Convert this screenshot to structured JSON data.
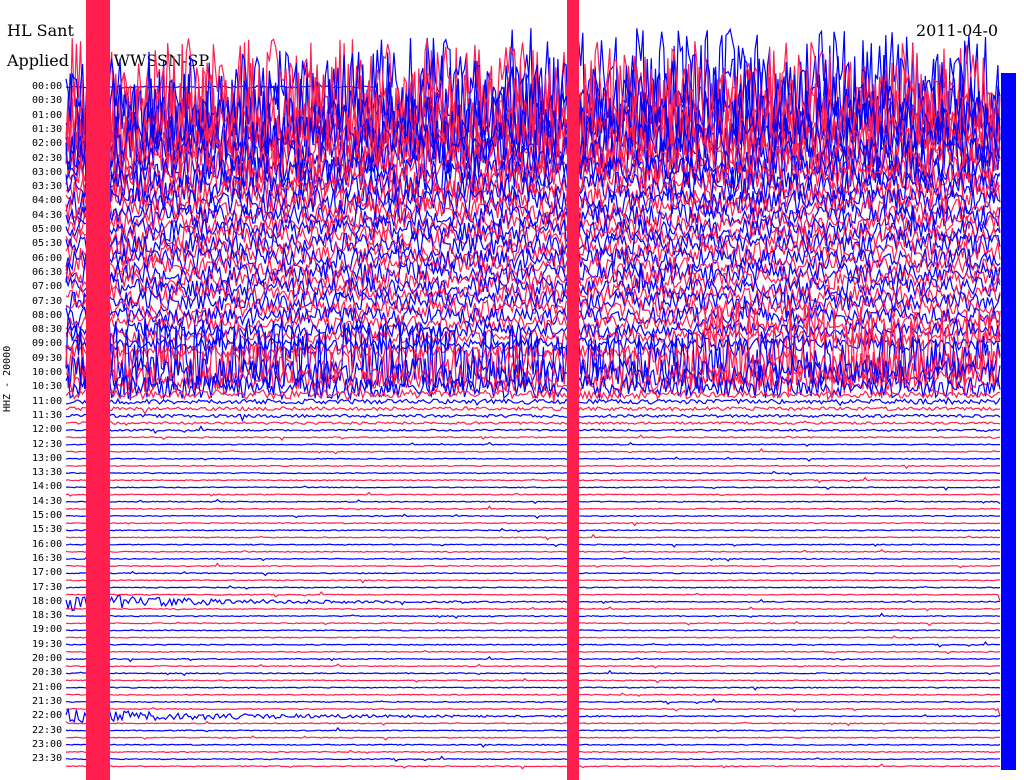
{
  "header": {
    "station": "HL Sant",
    "date": "2011-04-0",
    "filter_label": "Applied",
    "filter_value": ": WWSSN-SP"
  },
  "y_axis_label": "HHZ - 20000",
  "colors": {
    "trace_a": "#0000ff",
    "trace_b": "#ff1f4f",
    "background": "#ffffff"
  },
  "chart_data": {
    "type": "line",
    "title": "",
    "xlabel": "",
    "ylabel": "HHZ - 20000",
    "channel": "HHZ",
    "scale": 20000,
    "row_interval_minutes": 15,
    "hour_labels": [
      "00:00",
      "00:30",
      "01:00",
      "01:30",
      "02:00",
      "02:30",
      "03:00",
      "03:30",
      "04:00",
      "04:30",
      "05:00",
      "05:30",
      "06:00",
      "06:30",
      "07:00",
      "07:30",
      "08:00",
      "08:30",
      "09:00",
      "09:30",
      "10:00",
      "10:30",
      "11:00",
      "11:30",
      "12:00",
      "12:30",
      "13:00",
      "13:30",
      "14:00",
      "14:30",
      "15:00",
      "15:30",
      "16:00",
      "16:30",
      "17:00",
      "17:30",
      "18:00",
      "18:30",
      "19:00",
      "19:30",
      "20:00",
      "20:30",
      "21:00",
      "21:30",
      "22:00",
      "22:30",
      "23:00",
      "23:30"
    ],
    "row_count": 96,
    "series": [
      {
        "color": "#0000ff"
      },
      {
        "color": "#ff1f4f"
      }
    ],
    "noise_level": [
      0.15,
      0.15,
      0.15,
      0.15,
      0.15,
      0.15,
      0.15,
      0.15,
      0.15,
      0.15,
      0.16,
      0.16,
      0.16,
      0.16,
      0.17,
      0.17,
      0.18,
      0.2,
      0.25,
      0.3,
      0.55,
      0.55,
      0.75,
      0.75,
      0.85,
      0.85,
      1.0,
      1.0,
      1.05,
      1.05,
      1.05,
      1.05,
      1.05,
      1.0,
      0.9,
      0.9,
      0.75,
      0.85,
      0.95,
      1.0,
      1.2,
      1.35,
      1.55,
      0.55,
      0.4,
      0.3,
      0.25,
      0.2,
      0.15,
      0.1,
      0.08,
      0.08,
      0.08,
      0.08,
      0.08,
      0.08,
      0.08,
      0.08,
      0.08,
      0.08,
      0.08,
      0.08,
      0.08,
      0.08,
      0.08,
      0.08,
      0.08,
      0.08,
      0.08,
      0.08,
      0.08,
      0.08,
      0.08,
      0.08,
      0.08,
      0.08,
      0.08,
      0.08,
      0.08,
      0.08,
      0.08,
      0.08,
      0.08,
      0.08,
      0.08,
      0.08,
      0.08,
      0.08,
      0.08,
      0.08,
      0.08,
      0.08,
      0.08,
      0.08,
      0.08,
      0.08
    ],
    "events": [
      {
        "minutes": 5,
        "duration_minutes": 600,
        "amplitude": 10,
        "color": "#ff1f4f"
      },
      {
        "minutes": 565,
        "duration_minutes": 90,
        "amplitude": 8,
        "color": "#ff1f4f"
      },
      {
        "minutes": 1080,
        "duration_minutes": 8,
        "amplitude": 1.5,
        "color": "#0000ff"
      },
      {
        "minutes": 1320,
        "duration_minutes": 10,
        "amplitude": 1.2,
        "color": "#0000ff"
      }
    ]
  }
}
